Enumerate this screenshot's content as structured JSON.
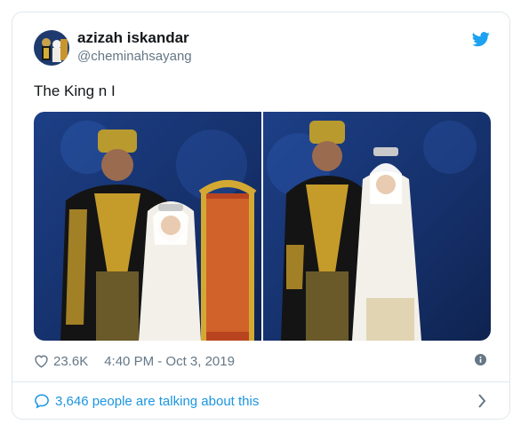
{
  "user": {
    "display_name": "azizah iskandar",
    "handle": "@cheminahsayang"
  },
  "tweet": {
    "text": "The King n I"
  },
  "meta": {
    "likes": "23.6K",
    "timestamp": "4:40 PM - Oct 3, 2019"
  },
  "footer": {
    "talking": "3,646 people are talking about this"
  },
  "icons": {
    "brand": "twitter-bird-icon",
    "like": "heart-icon",
    "info": "info-icon",
    "reply": "speech-bubble-icon",
    "more": "chevron-right-icon"
  },
  "colors": {
    "brand_blue": "#1da1f2",
    "link_blue": "#1b95e0",
    "secondary_text": "#657786",
    "border": "#e1e8ed"
  }
}
